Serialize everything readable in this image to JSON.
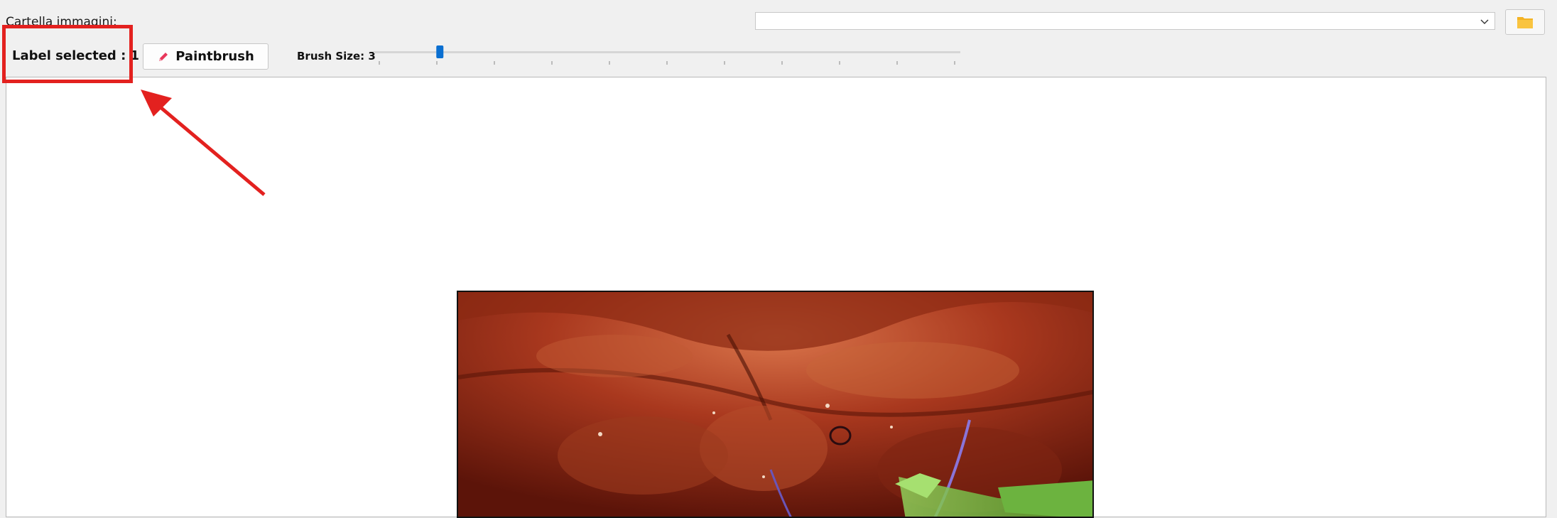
{
  "toolbar": {
    "folder_label": "Cartella immagini:",
    "path_value": "",
    "label_selected": "Label selected : 1",
    "paintbrush_label": "Paintbrush",
    "brush_size_label": "Brush Size: 3"
  },
  "brush_slider": {
    "min": 1,
    "max": 20,
    "value": 3
  },
  "icons": {
    "combo": "chevron-down-icon",
    "browse": "folder-icon",
    "paint": "pencil-icon"
  },
  "colors": {
    "accent": "#0a6fd1",
    "annotation": "#e3211f",
    "folder": "#f4b324",
    "pencil": "#e8375b"
  }
}
